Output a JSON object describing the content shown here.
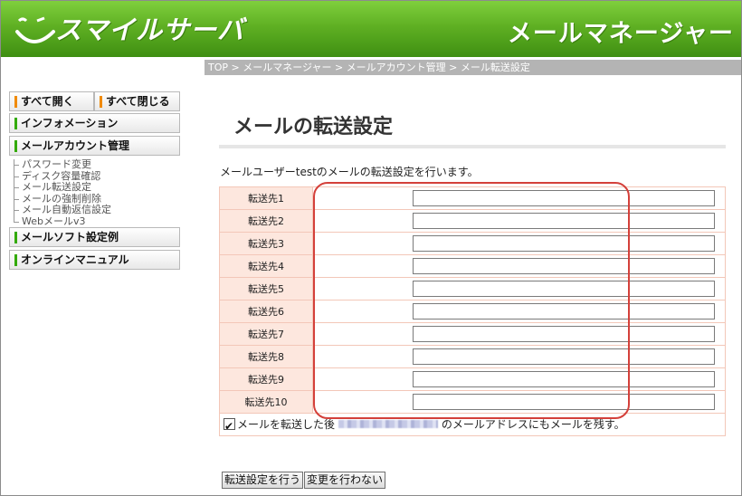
{
  "header": {
    "logo_text": "スマイルサーバ",
    "app_title": "メールマネージャー"
  },
  "breadcrumb": "TOP > メールマネージャー > メールアカウント管理 > メール転送設定",
  "sidebar": {
    "open_all": "すべて開く",
    "close_all": "すべて閉じる",
    "information": "インフォメーション",
    "mail_account": "メールアカウント管理",
    "tree_items": [
      "パスワード変更",
      "ディスク容量確認",
      "メール転送設定",
      "メールの強制削除",
      "メール自動返信設定",
      "Webメールv3"
    ],
    "mail_soft": "メールソフト設定例",
    "online_manual": "オンラインマニュアル"
  },
  "main": {
    "title": "メールの転送設定",
    "intro": "メールユーザーtestのメールの転送設定を行います。",
    "forward_labels": [
      "転送先1",
      "転送先2",
      "転送先3",
      "転送先4",
      "転送先5",
      "転送先6",
      "転送先7",
      "転送先8",
      "転送先9",
      "転送先10"
    ],
    "forward_values": [
      "",
      "",
      "",
      "",
      "",
      "",
      "",
      "",
      "",
      ""
    ],
    "keep_copy_before": "メールを転送した後",
    "keep_copy_after": "のメールアドレスにもメールを残す。",
    "keep_copy_checked": true,
    "apply_button": "転送設定を行う",
    "cancel_button": "変更を行わない"
  },
  "colors": {
    "header_green": "#5fb023",
    "label_bg": "#fde7de",
    "highlight": "#d4403a"
  }
}
